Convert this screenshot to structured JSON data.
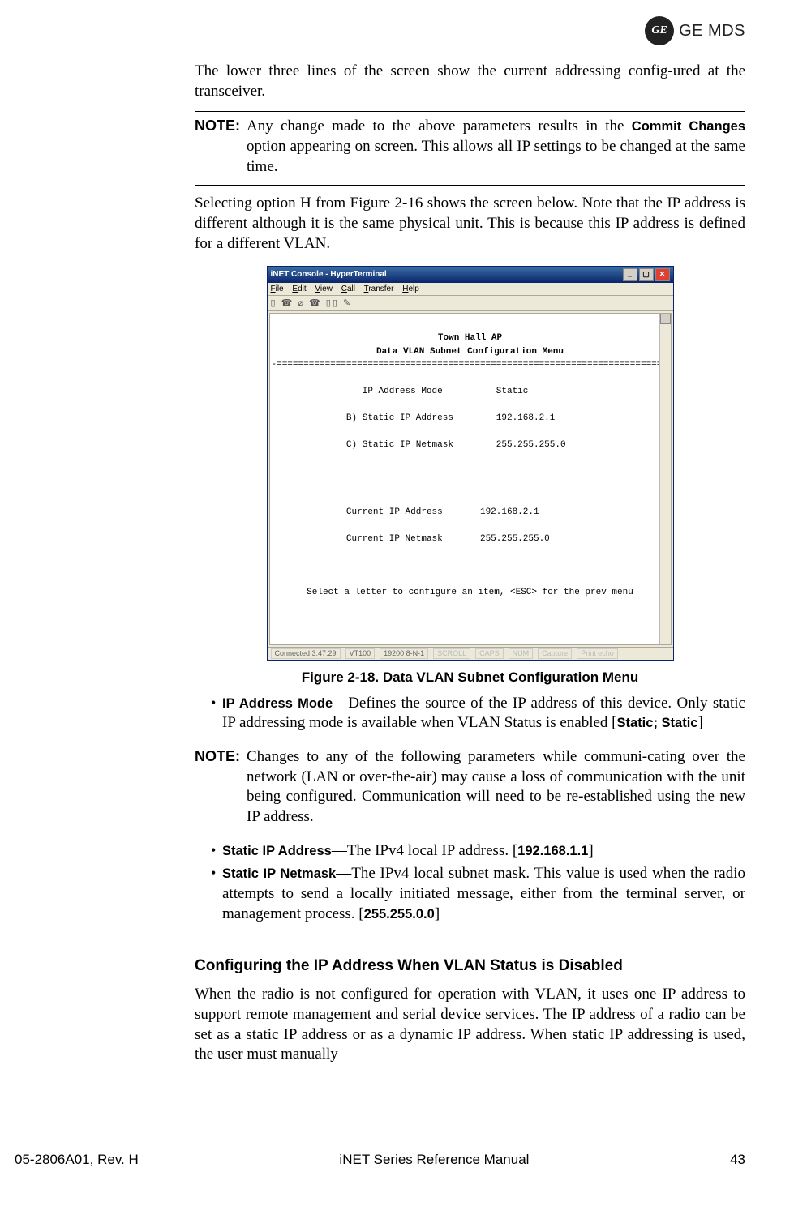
{
  "header": {
    "brand_short": "GE",
    "brand_text": "GE MDS"
  },
  "para1": "The lower three lines of the screen show the current addressing config-ured at the transceiver.",
  "note1": {
    "label": "NOTE:",
    "text_pre": "Any change made to the above parameters results in the ",
    "text_bold": "Commit Changes",
    "text_post": " option appearing on screen. This allows all IP settings to be changed at the same time."
  },
  "para2": "Selecting option H from Figure 2-16 shows the screen below. Note that the IP address is different although it is the same physical unit. This is because this IP address is defined for a different VLAN.",
  "terminal": {
    "title": "iNET Console - HyperTerminal",
    "menu": {
      "file": "File",
      "edit": "Edit",
      "view": "View",
      "call": "Call",
      "transfer": "Transfer",
      "help": "Help"
    },
    "toolbar_glyphs": "▯ ☎  ⌀ ☎  ▯▯ ✎",
    "line_title1": "Town Hall AP",
    "line_title2": "Data VLAN Subnet Configuration Menu",
    "sep": "-==========================================================================-",
    "row1_label": "IP Address Mode",
    "row1_val": "Static",
    "row2_label": "B) Static IP Address",
    "row2_val": "192.168.2.1",
    "row3_label": "C) Static IP Netmask",
    "row3_val": "255.255.255.0",
    "row4_label": "Current IP Address",
    "row4_val": "192.168.2.1",
    "row5_label": "Current IP Netmask",
    "row5_val": "255.255.255.0",
    "prompt": "Select a letter to configure an item, <ESC> for the prev menu",
    "status": {
      "conn": "Connected 3:47:29",
      "term": "VT100",
      "baud": "19200 8-N-1",
      "s1": "SCROLL",
      "s2": "CAPS",
      "s3": "NUM",
      "s4": "Capture",
      "s5": "Print echo"
    }
  },
  "fig_caption": "Figure 2-18. Data VLAN Subnet Configuration Menu",
  "bullet_ip_mode": {
    "term": "IP Address Mode",
    "desc": "—Defines the source of the IP address of this device. Only static IP addressing mode is available when VLAN Status is enabled [",
    "default": "Static; Static",
    "bracket_close": "]"
  },
  "note2": {
    "label": "NOTE:",
    "text": "Changes to any of the following parameters while communi-cating over the network (LAN or over-the-air) may cause a loss of communication with the unit being configured. Communication will need to be re-established using the new IP address."
  },
  "bullet_static_ip": {
    "term": "Static IP Address",
    "desc": "—The IPv4 local IP address. [",
    "default": "192.168.1.1",
    "bracket_close": "]"
  },
  "bullet_static_netmask": {
    "term": "Static IP Netmask",
    "desc": "—The IPv4 local subnet mask. This value is used when the radio attempts to send a locally initiated message, either from the terminal server, or management process. [",
    "default": "255.255.0.0",
    "bracket_close": "]"
  },
  "section_heading": "Configuring the IP Address When VLAN Status is Disabled",
  "para3": "When the radio is not configured for operation with VLAN, it uses one IP address to support remote management and serial device services. The IP address of a radio can be set as a static IP address or as a dynamic IP address. When static IP addressing is used, the user must manually",
  "footer": {
    "left": "05-2806A01, Rev. H",
    "center": "iNET Series Reference Manual",
    "right": "43"
  }
}
